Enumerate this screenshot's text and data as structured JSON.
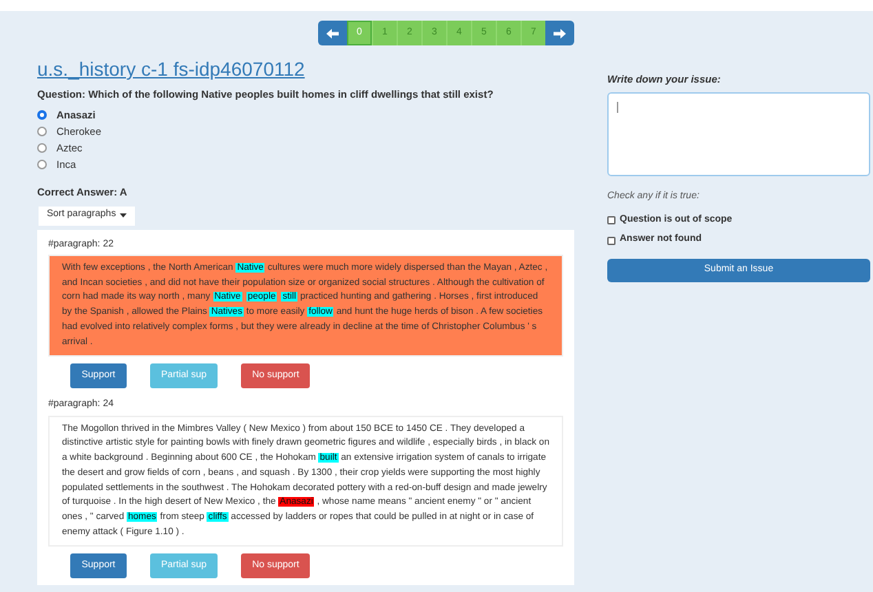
{
  "pagination": {
    "pages": [
      {
        "label": "0",
        "selected": true
      },
      {
        "label": "1",
        "selected": false
      },
      {
        "label": "2",
        "selected": false
      },
      {
        "label": "3",
        "selected": false
      },
      {
        "label": "4",
        "selected": false
      },
      {
        "label": "5",
        "selected": false
      },
      {
        "label": "6",
        "selected": false
      },
      {
        "label": "7",
        "selected": false
      }
    ]
  },
  "title": "u.s._history c-1 fs-idp46070112",
  "question": "Question: Which of the following Native peoples built homes in cliff dwellings that still exist?",
  "options": [
    {
      "label": "Anasazi",
      "selected": true
    },
    {
      "label": "Cherokee",
      "selected": false
    },
    {
      "label": "Aztec",
      "selected": false
    },
    {
      "label": "Inca",
      "selected": false
    }
  ],
  "correct_answer": "Correct Answer: A",
  "sort_button": "Sort paragraphs",
  "paragraphs": [
    {
      "label": "#paragraph: 22",
      "color": "#ff7f50",
      "segments": [
        {
          "text": "With few exceptions , the North American "
        },
        {
          "text": "Native",
          "color": "#00ffff"
        },
        {
          "text": " cultures were much more widely dispersed than the Mayan , Aztec , and Incan societies , and did not have their population size or organized social structures . Although the cultivation of corn had made its way north , many "
        },
        {
          "text": "Native",
          "color": "#00ffff"
        },
        {
          "text": "people",
          "color": "#00ffff"
        },
        {
          "text": "still",
          "color": "#00ffff"
        },
        {
          "text": " practiced hunting and gathering . Horses , first introduced by the Spanish , allowed the Plains "
        },
        {
          "text": "Natives",
          "color": "#00ffff"
        },
        {
          "text": " to more easily "
        },
        {
          "text": "follow",
          "color": "#00ffff"
        },
        {
          "text": " and hunt the huge herds of bison . A few societies had evolved into relatively complex forms , but they were already in decline at the time of Christopher Columbus ' s arrival ."
        }
      ],
      "buttons": [
        "Support",
        "Partial sup",
        "No support"
      ]
    },
    {
      "label": "#paragraph: 24",
      "color": "#ffffff",
      "segments": [
        {
          "text": "The Mogollon thrived in the Mimbres Valley ( New Mexico ) from about 150 BCE to 1450 CE . They developed a distinctive artistic style for painting bowls with finely drawn geometric figures and wildlife , especially birds , in black on a white background . Beginning about 600 CE , the Hohokam "
        },
        {
          "text": "built",
          "color": "#00ffff"
        },
        {
          "text": " an extensive irrigation system of canals to irrigate the desert and grow fields of corn , beans , and squash . By 1300 , their crop yields were supporting the most highly populated settlements in the southwest . The Hohokam decorated pottery with a red-on-buff design and made jewelry of turquoise . In the high desert of New Mexico , the "
        },
        {
          "text": "Anasazi",
          "color": "#ff0000"
        },
        {
          "text": " , whose name means \" ancient enemy \" or \" ancient ones , \" carved "
        },
        {
          "text": "homes",
          "color": "#00ffff"
        },
        {
          "text": " from steep "
        },
        {
          "text": "cliffs",
          "color": "#00ffff"
        },
        {
          "text": " accessed by ladders or ropes that could be pulled in at night or in case of enemy attack ( Figure 1.10 ) ."
        }
      ],
      "buttons": [
        "Support",
        "Partial sup",
        "No support"
      ]
    }
  ],
  "issue": {
    "label": "Write down your issue:",
    "check_label": "Check any if it is true:",
    "checks": [
      {
        "label": "Question is out of scope",
        "checked": false
      },
      {
        "label": "Answer not found",
        "checked": false
      }
    ],
    "submit": "Submit an Issue"
  }
}
